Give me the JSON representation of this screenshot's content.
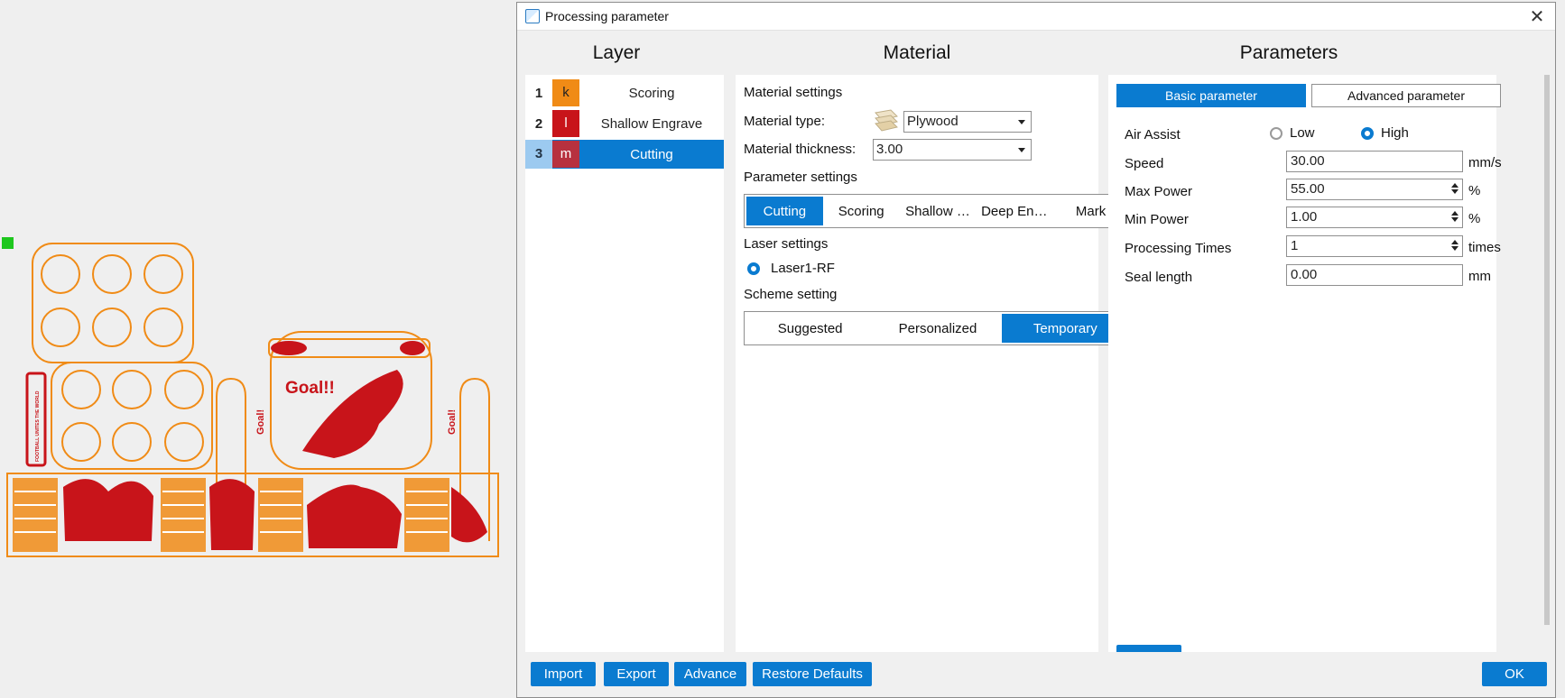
{
  "canvas": {
    "design_text_left": "Goal!",
    "design_text_center": "Goal!!",
    "design_text_right": "Goal!",
    "design_text_vertical": "FOOTBALL UNITES THE WORLD",
    "colors": {
      "cut": "#f08b16",
      "engrave": "#c8141a",
      "marker": "#1ec71e"
    }
  },
  "dialog": {
    "title": "Processing parameter",
    "close_glyph": "✕",
    "headers": {
      "layer": "Layer",
      "material": "Material",
      "parameters": "Parameters"
    }
  },
  "layers": [
    {
      "num": "1",
      "key": "k",
      "name": "Scoring",
      "color": "#f08b16",
      "key_color": "#222",
      "selected": false
    },
    {
      "num": "2",
      "key": "l",
      "name": "Shallow Engrave",
      "color": "#c8141a",
      "key_color": "#fff",
      "selected": false
    },
    {
      "num": "3",
      "key": "m",
      "name": "Cutting",
      "color": "#b7313f",
      "key_color": "#fff",
      "selected": true
    }
  ],
  "material": {
    "settings_label": "Material settings",
    "type_label": "Material type:",
    "type_value": "Plywood",
    "thickness_label": "Material thickness:",
    "thickness_value": "3.00",
    "param_settings_label": "Parameter settings",
    "param_tabs": [
      "Cutting",
      "Scoring",
      "Shallow …",
      "Deep En…",
      "Mark"
    ],
    "param_tab_selected": 0,
    "laser_label": "Laser settings",
    "laser_name": "Laser1-RF",
    "scheme_label": "Scheme setting",
    "scheme_tabs": [
      "Suggested",
      "Personalized",
      "Temporary"
    ],
    "scheme_tab_selected": 2
  },
  "parameters": {
    "tab_basic": "Basic parameter",
    "tab_advanced": "Advanced parameter",
    "air_assist_label": "Air Assist",
    "air_low": "Low",
    "air_high": "High",
    "air_selected": "High",
    "speed_label": "Speed",
    "speed_value": "30.00",
    "speed_unit": "mm/s",
    "maxpower_label": "Max Power",
    "maxpower_value": "55.00",
    "maxpower_unit": "%",
    "minpower_label": "Min Power",
    "minpower_value": "1.00",
    "minpower_unit": "%",
    "times_label": "Processing Times",
    "times_value": "1",
    "times_unit": "times",
    "seal_label": "Seal length",
    "seal_value": "0.00",
    "seal_unit": "mm"
  },
  "footer": {
    "import": "Import",
    "export": "Export",
    "advance": "Advance",
    "restore": "Restore Defaults",
    "ok": "OK"
  }
}
